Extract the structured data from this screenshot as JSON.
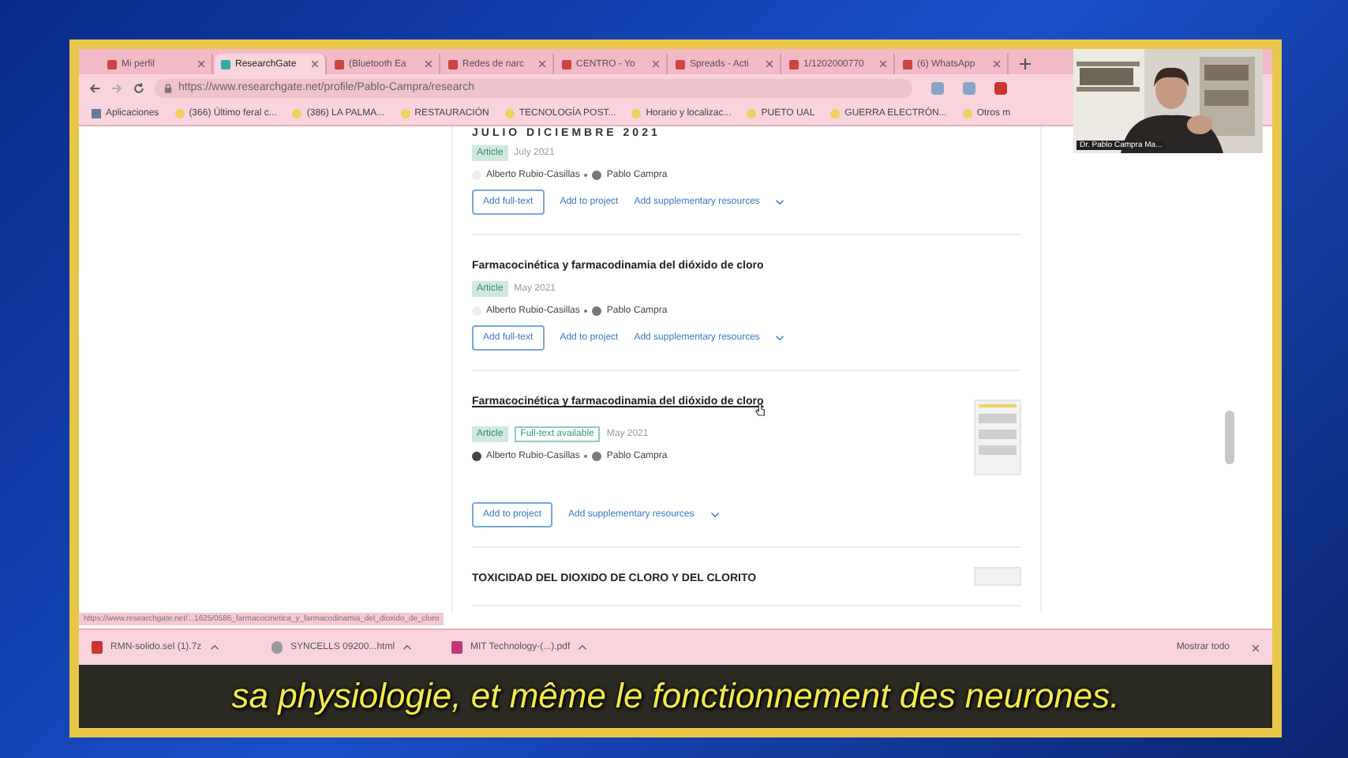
{
  "browser": {
    "tabs": [
      {
        "title": "Mi perfil",
        "selected": false
      },
      {
        "title": "ResearchGate",
        "selected": true
      },
      {
        "title": "(Bluetooth Ea",
        "selected": false
      },
      {
        "title": "Redes de narc",
        "selected": false
      },
      {
        "title": "CENTRO - Yo",
        "selected": false
      },
      {
        "title": "Spreads - Acti",
        "selected": false
      },
      {
        "title": "1/1202000770",
        "selected": false
      },
      {
        "title": "(6) WhatsApp",
        "selected": false
      }
    ],
    "url": "https://www.researchgate.net/profile/Pablo-Campra/research",
    "bookmarks": [
      "Aplicaciones",
      "(366) Último feral c...",
      "(386) LA PALMA...",
      "RESTAURACIÓN",
      "TECNOLOGÍA POST...",
      "Horario y localizac...",
      "PUETO UAL",
      "GUERRA ELECTRÓN...",
      "Otros m"
    ]
  },
  "page": {
    "section_heading": "JULIO DICIEMBRE 2021",
    "publications": [
      {
        "type": "Article",
        "date": "July 2021",
        "fulltext": false,
        "preview": false,
        "authors": [
          "Alberto Rubio-Casillas",
          "Pablo Campra"
        ],
        "actions": [
          {
            "label": "Add full-text",
            "kind": "outlined"
          },
          {
            "label": "Add to project",
            "kind": "link"
          },
          {
            "label": "Add supplementary resources",
            "kind": "link"
          }
        ]
      },
      {
        "title": "Farmacocinética y farmacodinamia del dióxido de cloro",
        "type": "Article",
        "date": "May 2021",
        "fulltext": false,
        "hovered": false,
        "preview": false,
        "authors": [
          "Alberto Rubio-Casillas",
          "Pablo Campra"
        ],
        "actions": [
          {
            "label": "Add full-text",
            "kind": "outlined"
          },
          {
            "label": "Add to project",
            "kind": "link"
          },
          {
            "label": "Add supplementary resources",
            "kind": "link"
          }
        ]
      },
      {
        "title": "Farmacocinética y farmacodinamia del dióxido de cloro",
        "type": "Article",
        "fulltext_label": "Full-text available",
        "date": "May 2021",
        "fulltext": true,
        "hovered": true,
        "preview": true,
        "authors": [
          "Alberto Rubio-Casillas",
          "Pablo Campra"
        ],
        "actions": [
          {
            "label": "Add to project",
            "kind": "outlined"
          },
          {
            "label": "Add supplementary resources",
            "kind": "link"
          }
        ]
      },
      {
        "title": "TOXICIDAD DEL DIOXIDO DE CLORO Y DEL CLORITO",
        "hovered": false,
        "preview": true
      }
    ]
  },
  "status_url": "https://www.researchgate.net/...1625/0586_farmacocinetica_y_farmacodinamia_del_dioxido_de_cloro",
  "downloads": [
    {
      "name": "RMN-solido.sel (1).7z",
      "kind": "archive"
    },
    {
      "name": "SYNCELLS 09200...html",
      "kind": "html"
    },
    {
      "name": "MIT Technology-(...).pdf",
      "kind": "pdf"
    }
  ],
  "show_all": "Mostrar todo",
  "video_call": {
    "caption": "Dr. Pablo Campra Ma..."
  },
  "subtitle": "sa physiologie, et même le fonctionnement des neurones."
}
